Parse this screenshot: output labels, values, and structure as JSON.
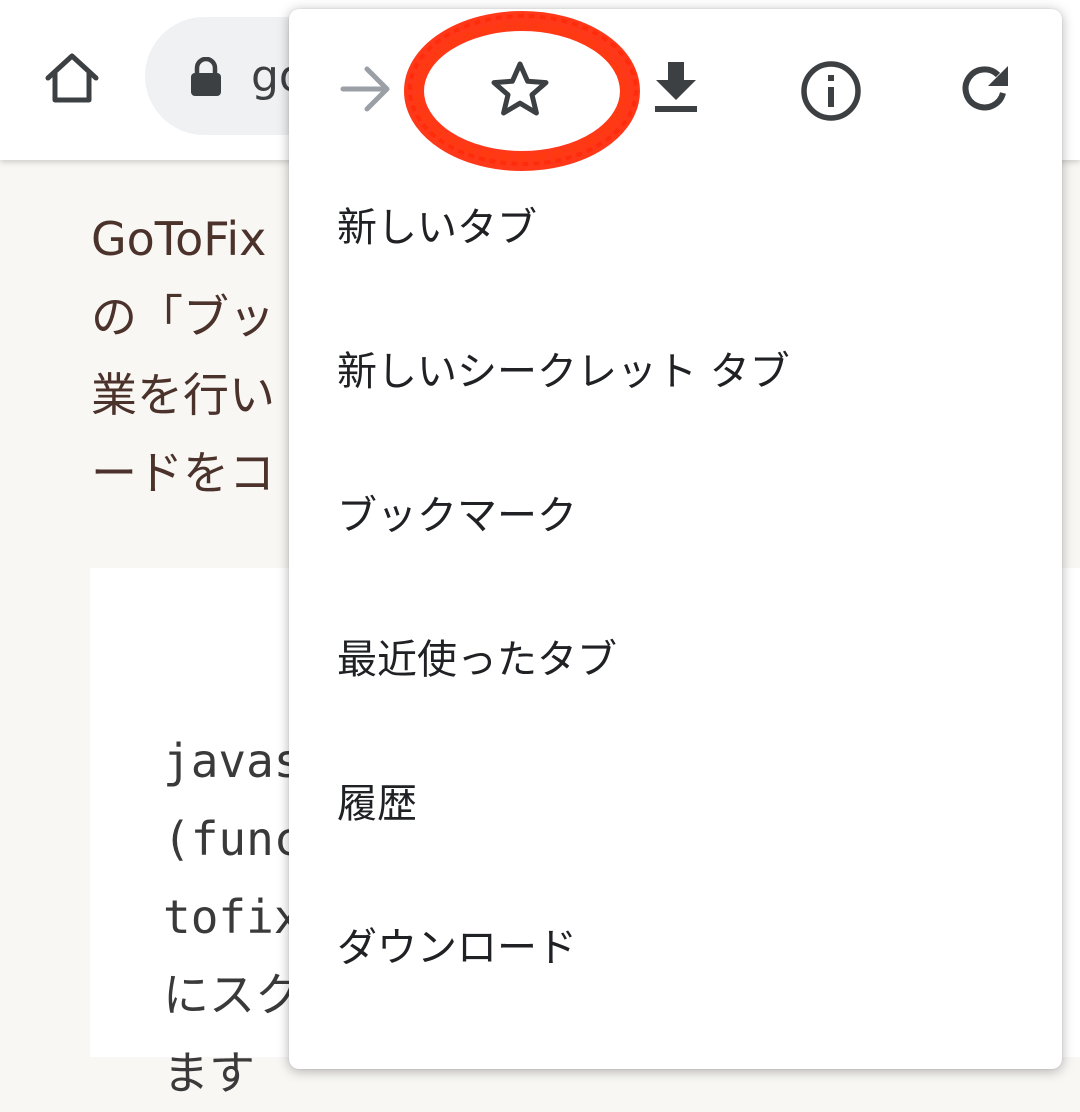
{
  "toolbar": {
    "home_icon": "home-icon",
    "lock_icon": "lock-icon",
    "url_visible": "go"
  },
  "content": {
    "paragraph_lines": [
      "GoToFix",
      "の「ブッ",
      "業を行い",
      "ードをコ"
    ],
    "code_lines": [
      "javas",
      "(func",
      "tofix",
      "にスク",
      "ます"
    ]
  },
  "menu": {
    "icons": [
      {
        "name": "forward-icon",
        "enabled": false
      },
      {
        "name": "star-icon",
        "enabled": true
      },
      {
        "name": "download-icon",
        "enabled": true
      },
      {
        "name": "info-icon",
        "enabled": true
      },
      {
        "name": "reload-icon",
        "enabled": true
      }
    ],
    "items": [
      {
        "label": "新しいタブ"
      },
      {
        "label": "新しいシークレット タブ"
      },
      {
        "label": "ブックマーク"
      },
      {
        "label": "最近使ったタブ"
      },
      {
        "label": "履歴"
      },
      {
        "label": "ダウンロード"
      }
    ]
  },
  "colors": {
    "highlight_circle": "#ff2200",
    "page_text": "#4b322b",
    "page_background": "#f8f7f4",
    "omnibox": "#eff1f3",
    "icon": "#3c4043",
    "disabled_icon": "#9aa0a6"
  }
}
